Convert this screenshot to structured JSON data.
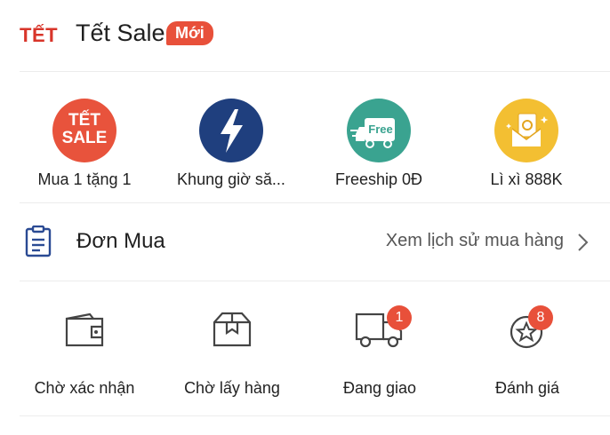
{
  "header": {
    "logo_text": "TẾT",
    "title": "Tết Sale",
    "badge": "Mới"
  },
  "promos": [
    {
      "label": "Mua 1 tặng 1",
      "icon": "tet-sale-icon",
      "icon_text_top": "TẾT",
      "icon_text_bottom": "SALE",
      "color": "#e8533c"
    },
    {
      "label": "Khung giờ să...",
      "icon": "lightning-icon",
      "color": "#1f3f7e"
    },
    {
      "label": "Freeship 0Đ",
      "icon": "free-truck-icon",
      "icon_text": "Free",
      "color": "#3aa390"
    },
    {
      "label": "Lì xì 888K",
      "icon": "red-envelope-icon",
      "color": "#f3bf32"
    }
  ],
  "orders": {
    "title": "Đơn Mua",
    "link_label": "Xem lịch sử mua hàng"
  },
  "order_status": [
    {
      "label": "Chờ xác nhận",
      "icon": "wallet-icon"
    },
    {
      "label": "Chờ lấy hàng",
      "icon": "box-icon"
    },
    {
      "label": "Đang giao",
      "icon": "delivery-truck-icon",
      "badge": "1"
    },
    {
      "label": "Đánh giá",
      "icon": "star-icon",
      "badge": "8"
    }
  ]
}
